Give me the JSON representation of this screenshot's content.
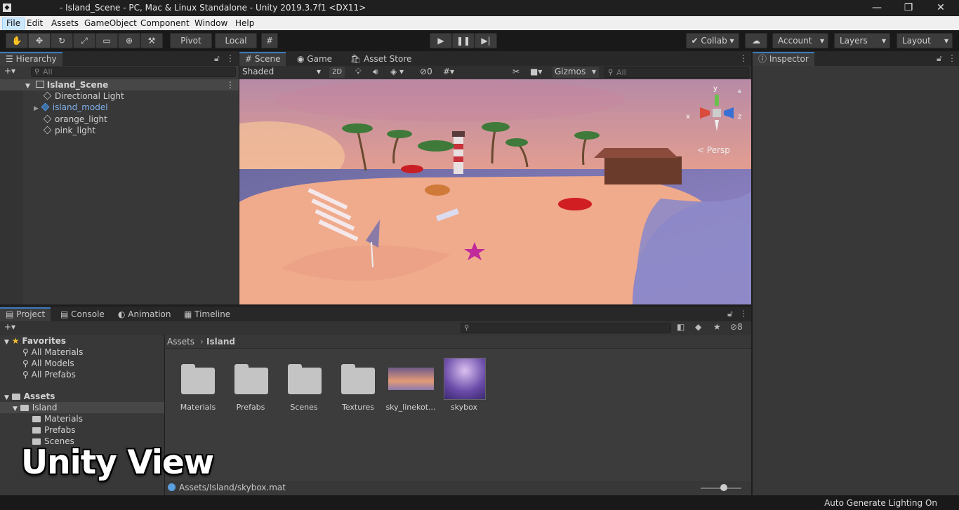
{
  "window": {
    "title": "- Island_Scene - PC, Mac & Linux Standalone - Unity 2019.3.7f1 <DX11>"
  },
  "menu": [
    "File",
    "Edit",
    "Assets",
    "GameObject",
    "Component",
    "Window",
    "Help"
  ],
  "toolbar": {
    "pivot": "Pivot",
    "local": "Local",
    "collab": "Collab",
    "account": "Account",
    "layers": "Layers",
    "layout": "Layout"
  },
  "hierarchy": {
    "tab": "Hierarchy",
    "search_placeholder": "All",
    "scene": "Island_Scene",
    "items": [
      "Directional Light",
      "island_model",
      "orange_light",
      "pink_light"
    ]
  },
  "scene_view": {
    "tabs": [
      "Scene",
      "Game",
      "Asset Store"
    ],
    "shading": "Shaded",
    "mode_2d": "2D",
    "hidden_count": "0",
    "gizmos": "Gizmos",
    "search_placeholder": "All",
    "persp": "Persp",
    "axes": {
      "x": "x",
      "y": "y",
      "z": "z"
    }
  },
  "inspector": {
    "tab": "Inspector"
  },
  "project": {
    "tabs": [
      "Project",
      "Console",
      "Animation",
      "Timeline"
    ],
    "hidden_count": "8",
    "favorites": {
      "title": "Favorites",
      "items": [
        "All Materials",
        "All Models",
        "All Prefabs"
      ]
    },
    "assets": {
      "title": "Assets",
      "island": "Island",
      "children": [
        "Materials",
        "Prefabs",
        "Scenes"
      ]
    },
    "breadcrumb": [
      "Assets",
      "Island"
    ],
    "grid": [
      "Materials",
      "Prefabs",
      "Scenes",
      "Textures",
      "sky_linekot...",
      "skybox"
    ],
    "selected_path": "Assets/Island/skybox.mat"
  },
  "status": {
    "text": "Auto Generate Lighting On"
  },
  "overlay": {
    "text": "Unity View"
  },
  "colors": {
    "accent": "#3a79bb",
    "selection": "#2c5d87"
  }
}
